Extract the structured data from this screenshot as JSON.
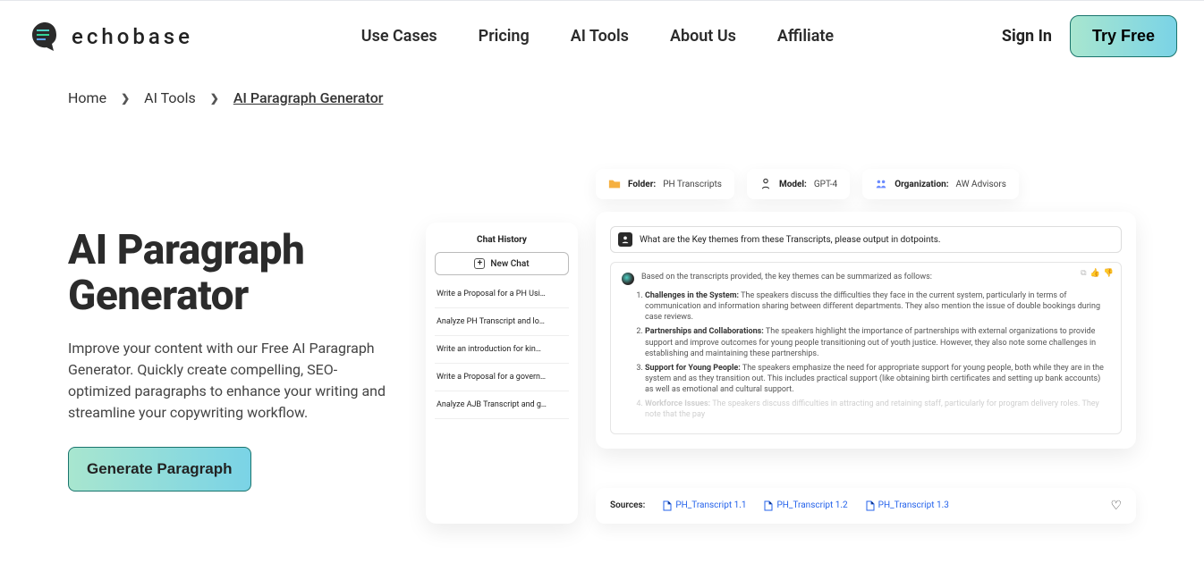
{
  "brand": "echobase",
  "nav": {
    "items": [
      "Use Cases",
      "Pricing",
      "AI Tools",
      "About Us",
      "Affiliate"
    ],
    "signin": "Sign In",
    "try": "Try Free"
  },
  "breadcrumb": {
    "home": "Home",
    "section": "AI Tools",
    "current": "AI Paragraph Generator"
  },
  "hero": {
    "title_l1": "AI Paragraph",
    "title_l2": "Generator",
    "desc": "Improve your content with our Free AI Paragraph Generator. Quickly create compelling, SEO-optimized paragraphs to enhance your writing and streamline your copywriting workflow.",
    "cta": "Generate Paragraph"
  },
  "pills": {
    "folder_label": "Folder:",
    "folder_value": "PH Transcripts",
    "model_label": "Model:",
    "model_value": "GPT-4",
    "org_label": "Organization:",
    "org_value": "AW Advisors"
  },
  "history": {
    "title": "Chat History",
    "new": "New Chat",
    "items": [
      "Write a Proposal for a PH Usi…",
      "Analyze PH Transcript and lo…",
      "Write an introduction for kin…",
      "Write a Proposal for a govern…",
      "Analyze AJB Transcript and g…"
    ]
  },
  "chat": {
    "user_msg": "What are the Key themes from these Transcripts, please output in dotpoints.",
    "ai_intro": "Based on the transcripts provided, the key themes can be summarized as follows:",
    "themes": [
      {
        "title": "Challenges in the System:",
        "body": "The speakers discuss the difficulties they face in the current system, particularly in terms of communication and information sharing between different departments. They also mention the issue of double bookings during case reviews."
      },
      {
        "title": "Partnerships and Collaborations:",
        "body": "The speakers highlight the importance of partnerships with external organizations to provide support and improve outcomes for young people transitioning out of youth justice. However, they also note some challenges in establishing and maintaining these partnerships."
      },
      {
        "title": "Support for Young People:",
        "body": "The speakers emphasize the need for appropriate support for young people, both while they are in the system and as they transition out. This includes practical support (like obtaining birth certificates and setting up bank accounts) as well as emotional and cultural support."
      },
      {
        "title": "Workforce Issues:",
        "body": "The speakers discuss difficulties in attracting and retaining staff, particularly for program delivery roles. They note that the pay"
      }
    ]
  },
  "sources": {
    "label": "Sources:",
    "items": [
      "PH_Transcript 1.1",
      "PH_Transcript 1.2",
      "PH_Transcript 1.3"
    ]
  }
}
